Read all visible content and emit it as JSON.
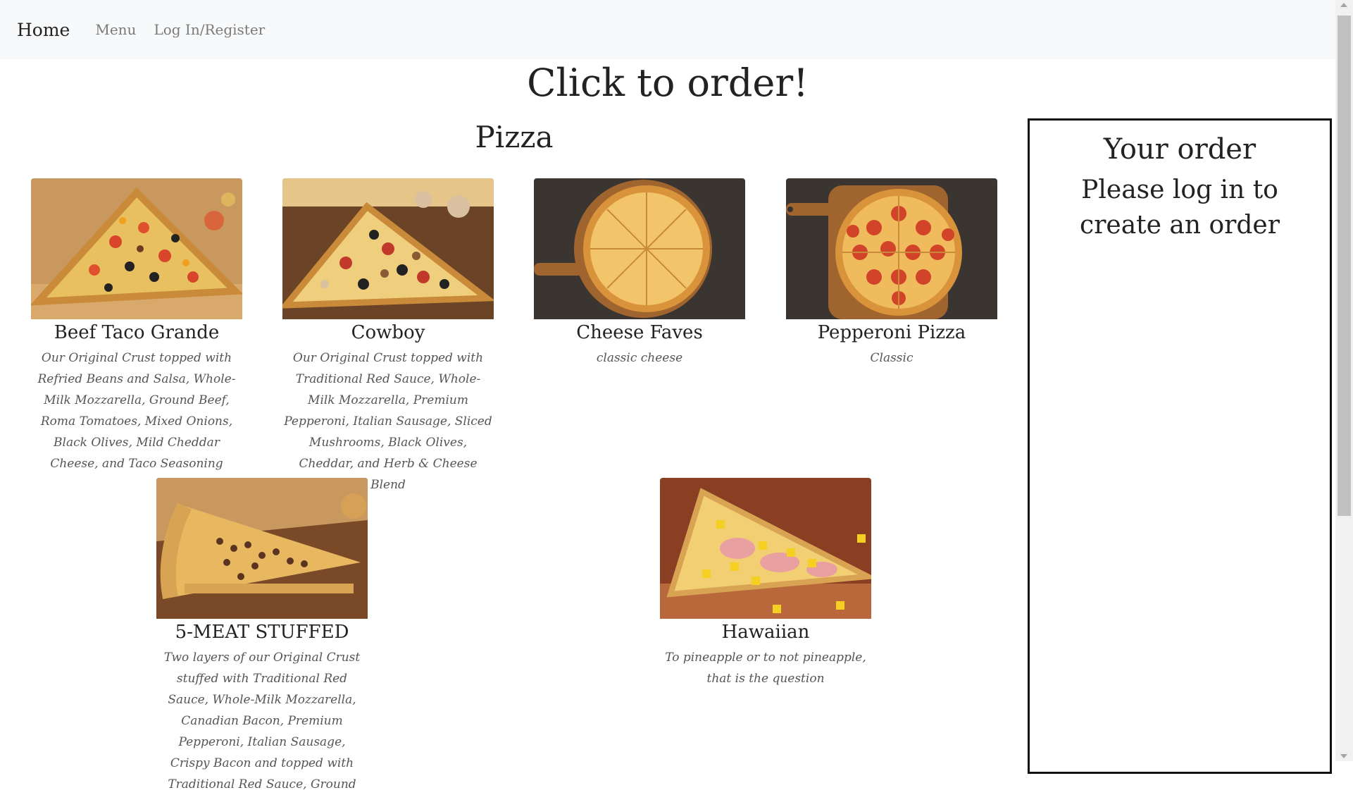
{
  "nav": {
    "brand": "Home",
    "links": [
      "Menu",
      "Log In/Register"
    ]
  },
  "page": {
    "heading": "Click to order!"
  },
  "section": {
    "title": "Pizza"
  },
  "items": [
    {
      "name": "Beef Taco Grande",
      "description": "Our Original Crust topped with Refried Beans and Salsa, Whole-Milk Mozzarella, Ground Beef, Roma Tomatoes, Mixed Onions, Black Olives, Mild Cheddar Cheese, and Taco Seasoning",
      "image": "beef-taco-pizza-slice"
    },
    {
      "name": "Cowboy",
      "description": "Our Original Crust topped with Traditional Red Sauce, Whole-Milk Mozzarella, Premium Pepperoni, Italian Sausage, Sliced Mushrooms, Black Olives, Cheddar, and Herb & Cheese Blend",
      "image": "cowboy-pizza-slice"
    },
    {
      "name": "Cheese Faves",
      "description": "classic cheese",
      "image": "cheese-pizza-whole"
    },
    {
      "name": "Pepperoni Pizza",
      "description": "Classic",
      "image": "pepperoni-pizza-whole"
    },
    {
      "name": "5-MEAT STUFFED",
      "description": "Two layers of our Original Crust stuffed with Traditional Red Sauce, Whole-Milk Mozzarella, Canadian Bacon, Premium Pepperoni, Italian Sausage, Crispy Bacon and topped with Traditional Red Sauce, Ground",
      "image": "stuffed-pizza-slice"
    },
    {
      "name": "Hawaiian",
      "description": "To pineapple or to not pineapple, that is the question",
      "image": "hawaiian-pizza-slice"
    }
  ],
  "order": {
    "title": "Your order",
    "message": "Please log in to create an order"
  },
  "colors": {
    "navbar_bg": "#f8f9fa",
    "text": "#222222",
    "muted": "#7a7a7a",
    "wood": "#b5743a",
    "dark_board": "#3a3530"
  }
}
